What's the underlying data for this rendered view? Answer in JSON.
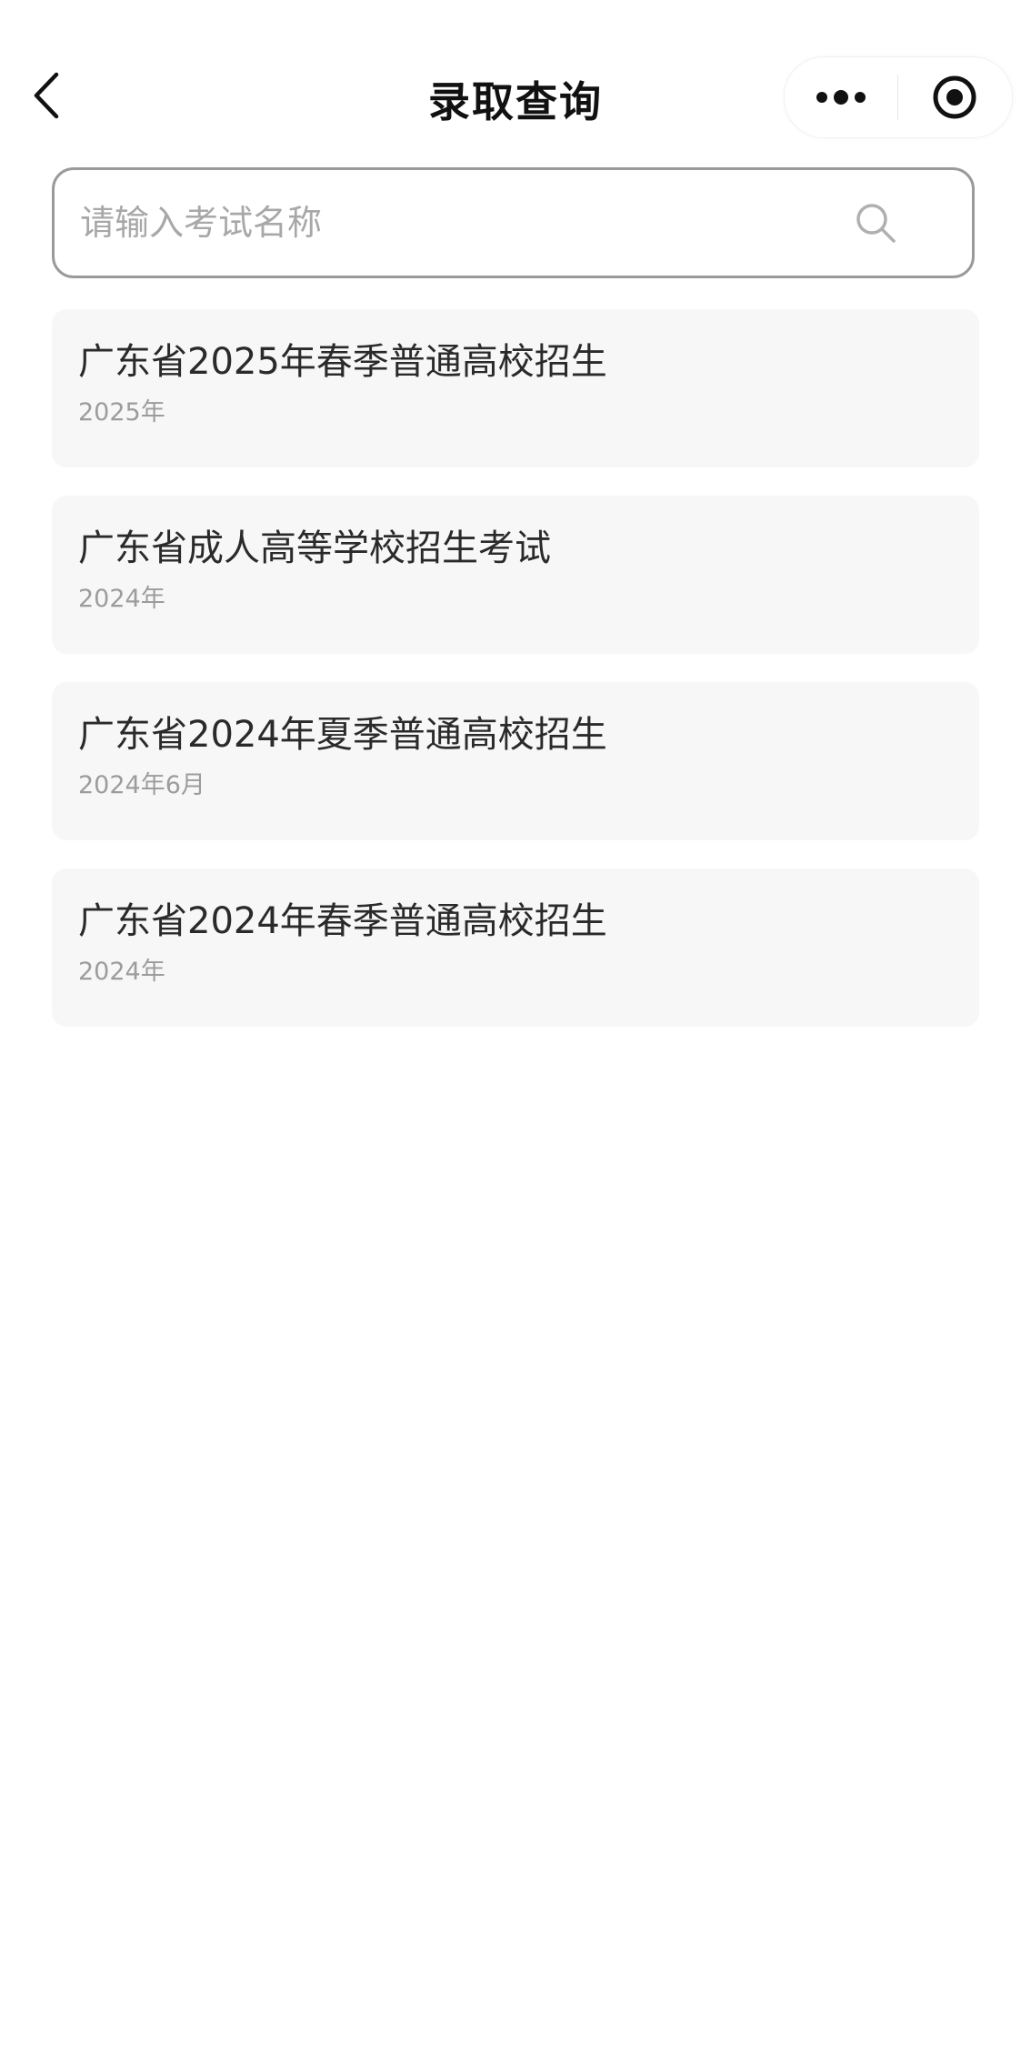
{
  "header": {
    "title": "录取查询",
    "back_icon": "chevron-left-icon",
    "more_icon": "more-dots-icon",
    "close_icon": "target-circle-icon"
  },
  "search": {
    "placeholder": "请输入考试名称",
    "value": "",
    "icon": "search-icon"
  },
  "exams": [
    {
      "name": "广东省2025年春季普通高校招生",
      "date": "2025年"
    },
    {
      "name": "广东省成人高等学校招生考试",
      "date": "2024年"
    },
    {
      "name": "广东省2024年夏季普通高校招生",
      "date": "2024年6月"
    },
    {
      "name": "广东省2024年春季普通高校招生",
      "date": "2024年"
    }
  ],
  "colors": {
    "card_background": "#f7f7f7",
    "search_border": "#9a9a9a",
    "placeholder": "#a8a8a8",
    "secondary_text": "#9c9c9c"
  }
}
